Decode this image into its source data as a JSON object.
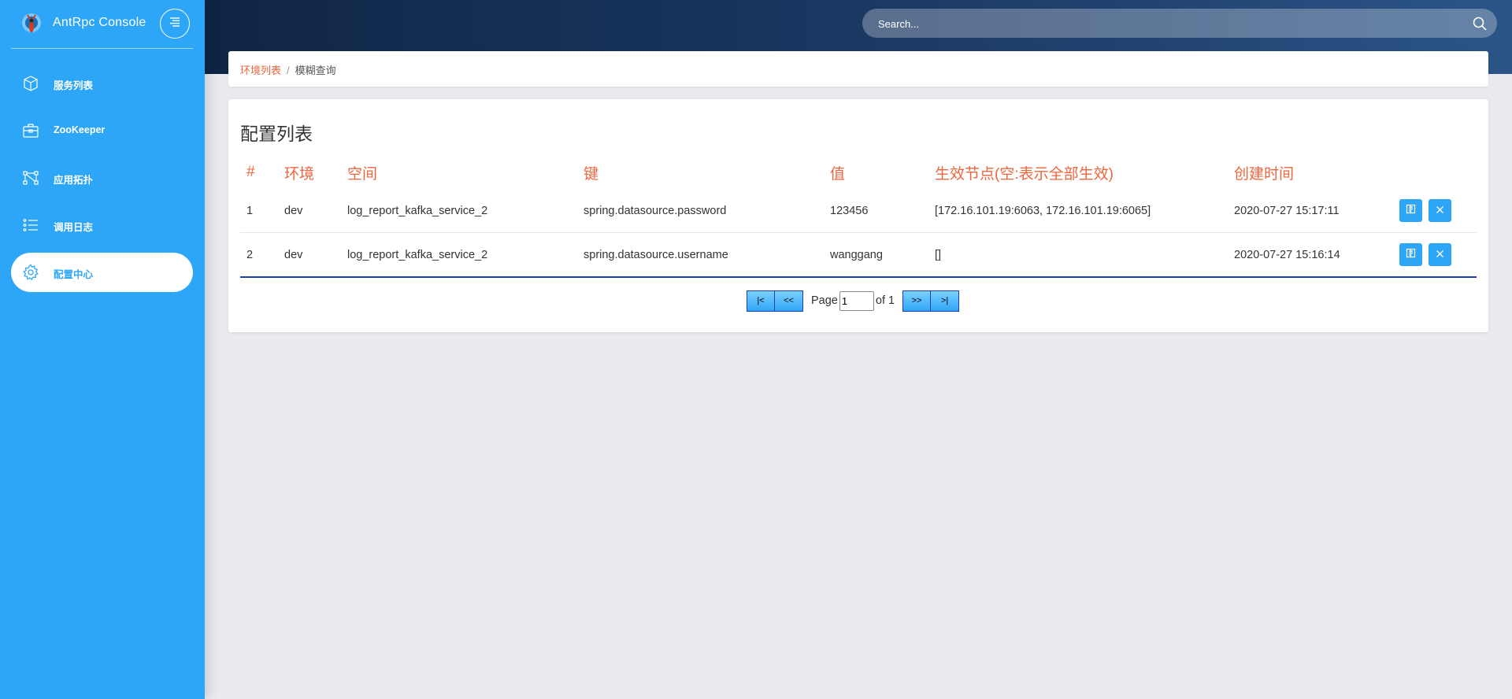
{
  "app": {
    "title": "AntRpc Console"
  },
  "sidebar": {
    "items": [
      {
        "label": "服务列表",
        "icon": "cube-icon",
        "active": false
      },
      {
        "label": "ZooKeeper",
        "icon": "briefcase-icon",
        "active": false
      },
      {
        "label": "应用拓扑",
        "icon": "topology-icon",
        "active": false
      },
      {
        "label": "调用日志",
        "icon": "list-icon",
        "active": false
      },
      {
        "label": "配置中心",
        "icon": "gear-icon",
        "active": true
      }
    ]
  },
  "search": {
    "placeholder": "Search..."
  },
  "breadcrumb": {
    "parent": "环境列表",
    "separator": "/",
    "current": "模糊查询"
  },
  "main": {
    "title": "配置列表",
    "columns": [
      "#",
      "环境",
      "空间",
      "键",
      "值",
      "生效节点(空:表示全部生效)",
      "创建时间"
    ],
    "rows": [
      {
        "index": "1",
        "env": "dev",
        "space": "log_report_kafka_service_2",
        "key": "spring.datasource.password",
        "value": "123456",
        "nodes": "[172.16.101.19:6063, 172.16.101.19:6065]",
        "created": "2020-07-27 15:17:11"
      },
      {
        "index": "2",
        "env": "dev",
        "space": "log_report_kafka_service_2",
        "key": "spring.datasource.username",
        "value": "wanggang",
        "nodes": "[]",
        "created": "2020-07-27 15:16:14"
      }
    ]
  },
  "pager": {
    "first": "|<",
    "prev": "<<",
    "page_label": "Page",
    "page_value": "1",
    "of_label": "of 1",
    "next": ">>",
    "last": ">|"
  },
  "colors": {
    "sidebar": "#2ea6f7",
    "accent": "#f0643c",
    "header_start": "#0f2545",
    "header_end": "#2b5487"
  }
}
